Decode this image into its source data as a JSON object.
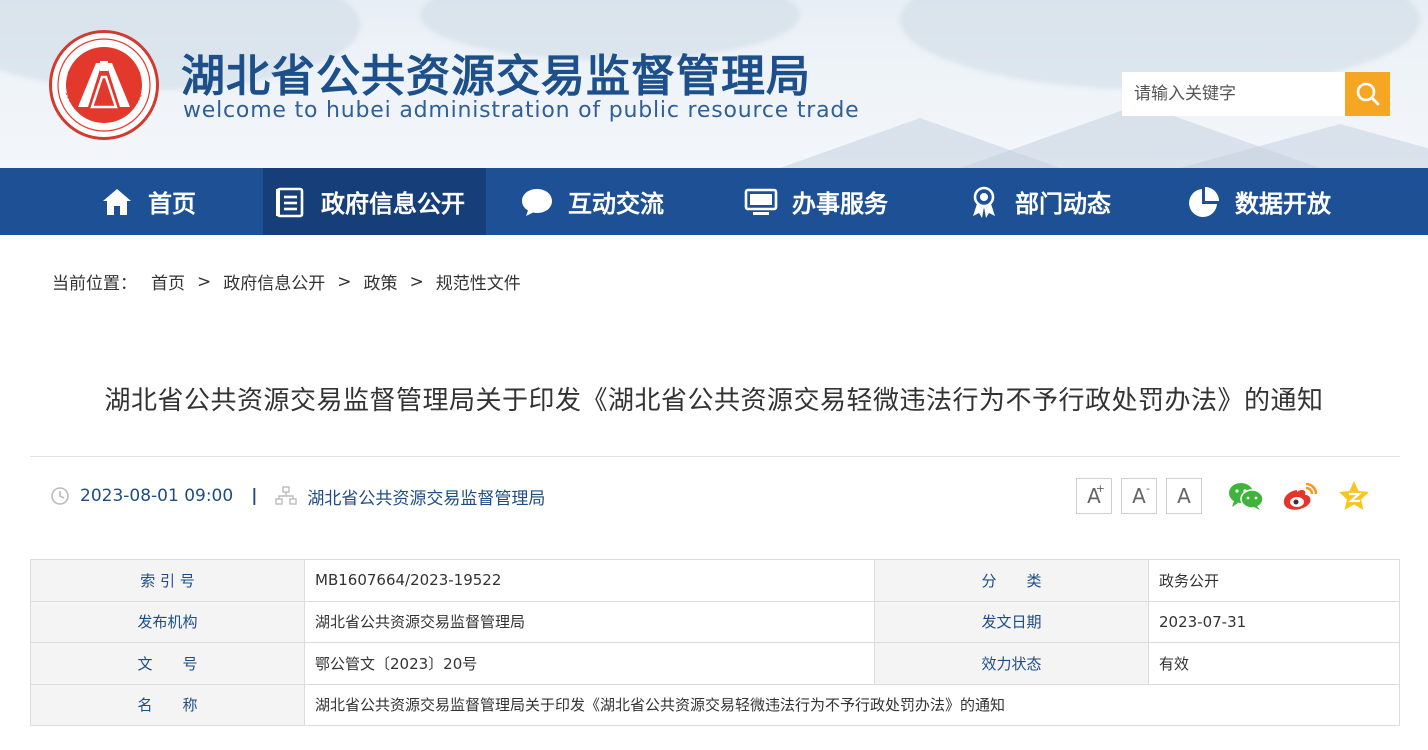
{
  "header": {
    "title": "湖北省公共资源交易监督管理局",
    "subtitle": "welcome to hubei administration of public resource trade",
    "search_placeholder": "请输入关键字"
  },
  "nav": {
    "items": [
      {
        "label": "首页",
        "icon": "home-icon"
      },
      {
        "label": "政府信息公开",
        "icon": "list-document-icon"
      },
      {
        "label": "互动交流",
        "icon": "chat-bubble-icon"
      },
      {
        "label": "办事服务",
        "icon": "monitor-icon"
      },
      {
        "label": "部门动态",
        "icon": "award-badge-icon"
      },
      {
        "label": "数据开放",
        "icon": "pie-chart-icon"
      }
    ],
    "active_index": 1
  },
  "breadcrumb": {
    "label": "当前位置：",
    "items": [
      "首页",
      "政府信息公开",
      "政策",
      "规范性文件"
    ],
    "separator": ">"
  },
  "article": {
    "title": "湖北省公共资源交易监督管理局关于印发《湖北省公共资源交易轻微违法行为不予行政处罚办法》的通知",
    "date": "2023-08-01 09:00",
    "pipe": "|",
    "source": "湖北省公共资源交易监督管理局"
  },
  "font_buttons": [
    "A",
    "A",
    "A"
  ],
  "font_button_marks": [
    "+",
    "-"
  ],
  "share": [
    "wechat-icon",
    "weibo-icon",
    "qzone-icon"
  ],
  "colors": {
    "nav_bg": "#1e5096",
    "nav_active": "#163f7a",
    "search_button": "#f5a623",
    "title_blue": "#1d4f8a",
    "emblem_red": "#e3392d"
  },
  "info": {
    "rows": [
      {
        "k1": "索 引 号",
        "v1": "MB1607664/2023-19522",
        "k2": "分　　类",
        "v2": "政务公开"
      },
      {
        "k1": "发布机构",
        "v1": "湖北省公共资源交易监督管理局",
        "k2": "发文日期",
        "v2": "2023-07-31"
      },
      {
        "k1": "文　　号",
        "v1": "鄂公管文〔2023〕20号",
        "k2": "效力状态",
        "v2": "有效"
      }
    ],
    "name_key": "名　　称",
    "name_value": "湖北省公共资源交易监督管理局关于印发《湖北省公共资源交易轻微违法行为不予行政处罚办法》的通知"
  }
}
